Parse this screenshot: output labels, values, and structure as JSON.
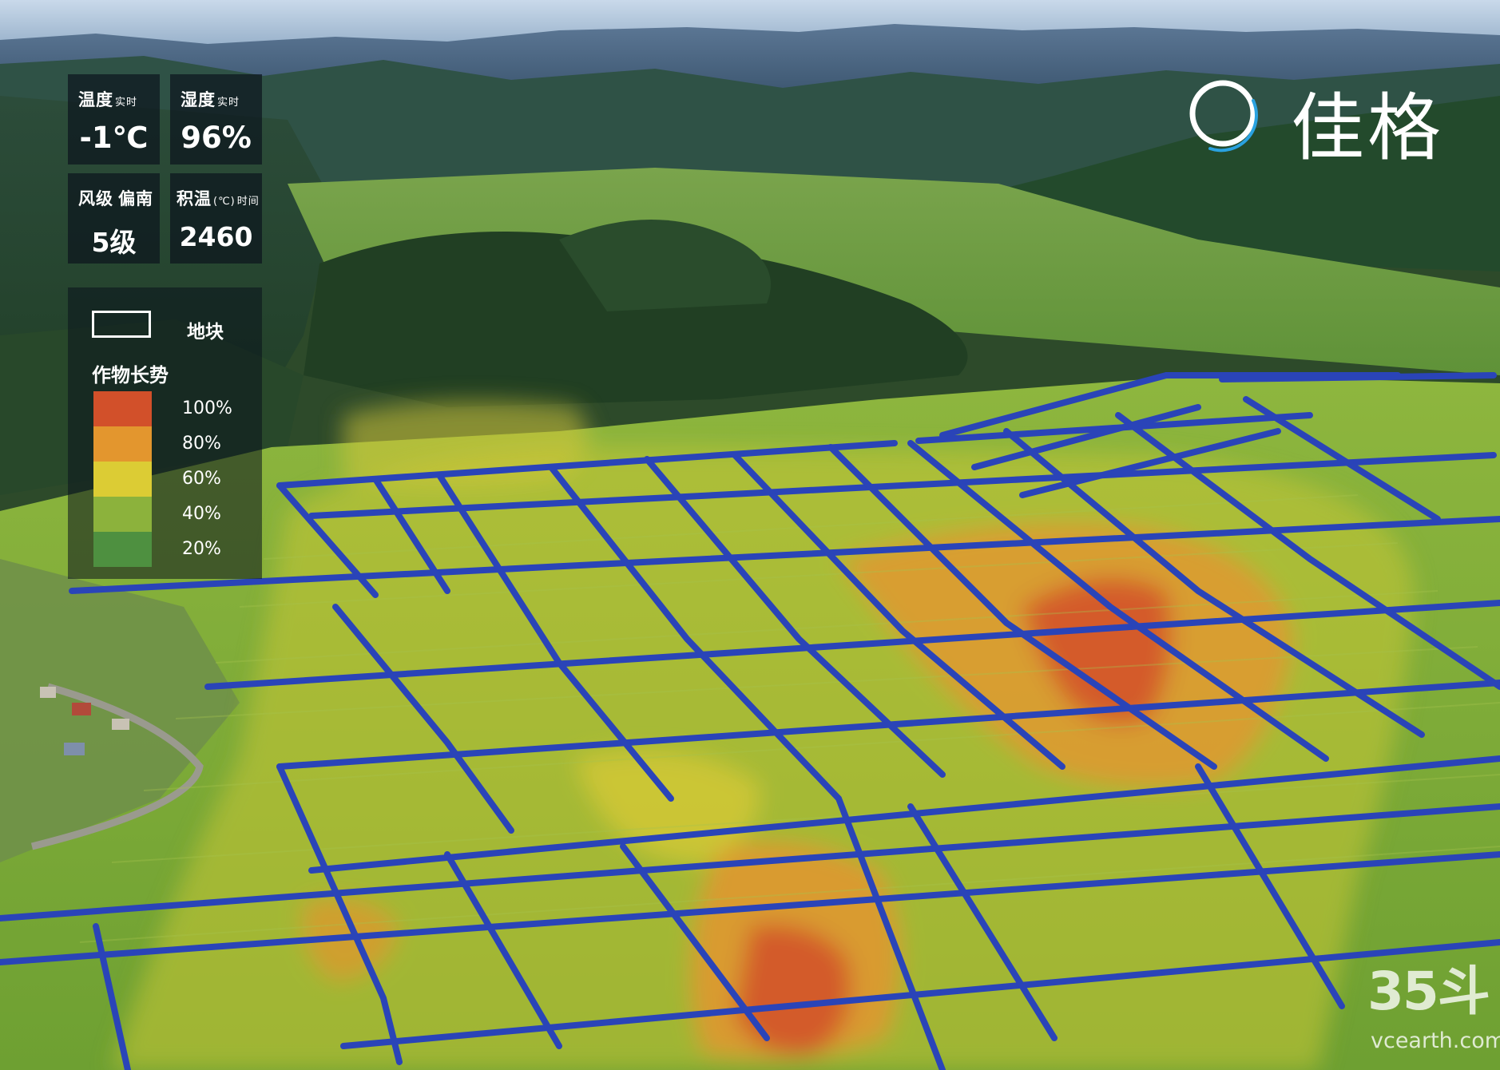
{
  "stats": {
    "temperature": {
      "label": "温度",
      "tag": "实时",
      "value": "-1℃"
    },
    "humidity": {
      "label": "湿度",
      "tag": "实时",
      "value": "96%"
    },
    "wind": {
      "label": "风级",
      "direction": "偏南",
      "value": "5级"
    },
    "accumulated_temp": {
      "label": "积温",
      "unit": "(℃)",
      "tag": "时间",
      "value": "2460"
    }
  },
  "legend": {
    "plot_label": "地块",
    "growth_title": "作物长势",
    "scale": [
      {
        "label": "100%",
        "color": "#d2502a"
      },
      {
        "label": "80%",
        "color": "#e3962e"
      },
      {
        "label": "60%",
        "color": "#dccc34"
      },
      {
        "label": "40%",
        "color": "#8cb23c"
      },
      {
        "label": "20%",
        "color": "#4e9040"
      }
    ]
  },
  "brand": {
    "name": "佳格",
    "ring_color": "#2aa2e0"
  },
  "watermark": {
    "number": "35斗",
    "url": "vcearth.com"
  },
  "colors": {
    "grid_line": "#2a44b8",
    "field": "#8cb23c",
    "forest": "#25482a",
    "sky": "#9bb9d6"
  }
}
